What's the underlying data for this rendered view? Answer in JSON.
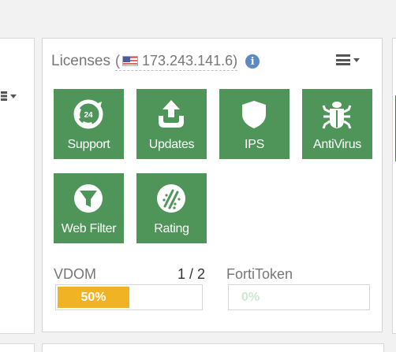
{
  "widget": {
    "title": "Licenses",
    "ip_open": "(",
    "ip_address": "173.243.141.6",
    "ip_close": ")",
    "info_icon": "info-icon",
    "menu_icon": "hamburger-menu-icon",
    "flag_icon": "us-flag-icon"
  },
  "tiles": [
    {
      "label": "Support",
      "icon": "support-24-icon",
      "status": "licensed"
    },
    {
      "label": "Updates",
      "icon": "upload-icon",
      "status": "licensed"
    },
    {
      "label": "IPS",
      "icon": "shield-icon",
      "status": "licensed"
    },
    {
      "label": "AntiVirus",
      "icon": "bug-icon",
      "status": "licensed"
    },
    {
      "label": "Web Filter",
      "icon": "filter-funnel-icon",
      "status": "licensed"
    },
    {
      "label": "Rating",
      "icon": "rating-icon",
      "status": "licensed"
    }
  ],
  "support_badge": "24",
  "usage": {
    "vdom": {
      "label": "VDOM",
      "count": "1 / 2",
      "percent_text": "50%",
      "fraction": 0.5
    },
    "fortitoken": {
      "label": "FortiToken",
      "percent_text": "0%",
      "fraction": 0.0
    }
  },
  "colors": {
    "tile_green": "#4f955a",
    "bar_yellow": "#f0b323",
    "zero_text": "#cfe8d2"
  }
}
